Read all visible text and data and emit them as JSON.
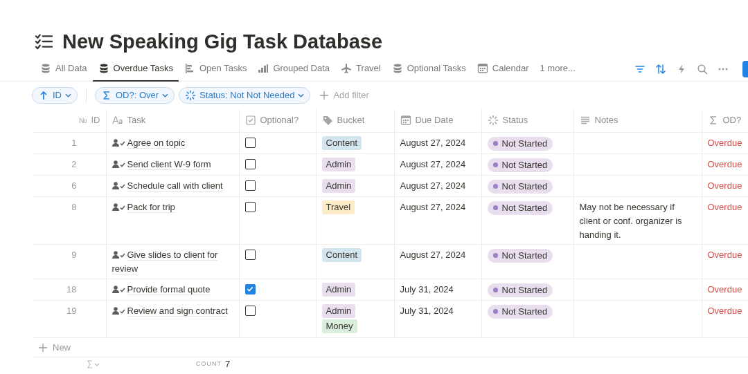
{
  "page": {
    "title": "New Speaking Gig Task Database"
  },
  "tabs": [
    {
      "label": "All Data",
      "kind": "database",
      "selected": false
    },
    {
      "label": "Overdue Tasks",
      "kind": "database",
      "selected": true
    },
    {
      "label": "Open Tasks",
      "kind": "timeline",
      "selected": false
    },
    {
      "label": "Grouped Data",
      "kind": "chart",
      "selected": false
    },
    {
      "label": "Travel",
      "kind": "plane",
      "selected": false
    },
    {
      "label": "Optional Tasks",
      "kind": "database",
      "selected": false
    },
    {
      "label": "Calendar",
      "kind": "calendar",
      "selected": false
    },
    {
      "label": "1 more...",
      "kind": "overflow",
      "selected": false
    }
  ],
  "toolbar": [
    {
      "kind": "filter",
      "active": true
    },
    {
      "kind": "sort",
      "active": true
    },
    {
      "kind": "automation",
      "active": false
    },
    {
      "kind": "search",
      "active": false
    },
    {
      "kind": "more",
      "active": false
    }
  ],
  "sorts": [
    {
      "label": "ID"
    }
  ],
  "filters": [
    {
      "label": "OD?: Over",
      "kind": "sigma"
    },
    {
      "label": "Status: Not Not Needed",
      "kind": "status"
    }
  ],
  "add_filter": "Add filter",
  "table": {
    "columns": [
      {
        "label": "ID",
        "kind": "number",
        "symbol": "№"
      },
      {
        "label": "Task",
        "kind": "title"
      },
      {
        "label": "Optional?",
        "kind": "checkbox"
      },
      {
        "label": "Bucket",
        "kind": "tag"
      },
      {
        "label": "Due Date",
        "kind": "calendar"
      },
      {
        "label": "Status",
        "kind": "status"
      },
      {
        "label": "Notes",
        "kind": "text"
      },
      {
        "label": "OD?",
        "kind": "sigma"
      }
    ],
    "rows": [
      {
        "id": "1",
        "task": "Agree on topic",
        "optional": false,
        "bucket": [
          {
            "label": "Content",
            "color": "#d3e5ef"
          }
        ],
        "due": "August 27, 2024",
        "status": {
          "label": "Not Started",
          "color": "#9b80c4"
        },
        "od": "Overdue"
      },
      {
        "id": "2",
        "task": "Send client W-9 form",
        "optional": false,
        "bucket": [
          {
            "label": "Admin",
            "color": "#e8deee"
          }
        ],
        "due": "August 27, 2024",
        "status": {
          "label": "Not Started",
          "color": "#9b80c4"
        },
        "od": "Overdue"
      },
      {
        "id": "6",
        "task": "Schedule call with client",
        "optional": false,
        "bucket": [
          {
            "label": "Admin",
            "color": "#e8deee"
          }
        ],
        "due": "August 27, 2024",
        "status": {
          "label": "Not Started",
          "color": "#9b80c4"
        },
        "od": "Overdue"
      },
      {
        "id": "8",
        "task": "Pack for trip",
        "optional": false,
        "bucket": [
          {
            "label": "Travel",
            "color": "#fdecc8"
          }
        ],
        "due": "August 27, 2024",
        "status": {
          "label": "Not Started",
          "color": "#9b80c4"
        },
        "notes": "May not be necessary if client or conf. organizer is handing it.",
        "od": "Overdue"
      },
      {
        "id": "9",
        "task": "Give slides to client for review",
        "optional": false,
        "bucket": [
          {
            "label": "Content",
            "color": "#d3e5ef"
          }
        ],
        "due": "August 27, 2024",
        "status": {
          "label": "Not Started",
          "color": "#9b80c4"
        },
        "od": "Overdue"
      },
      {
        "id": "18",
        "task": "Provide formal quote",
        "optional": true,
        "bucket": [
          {
            "label": "Admin",
            "color": "#e8deee"
          }
        ],
        "due": "July 31, 2024",
        "status": {
          "label": "Not Started",
          "color": "#9b80c4"
        },
        "od": "Overdue"
      },
      {
        "id": "19",
        "task": "Review and sign contract",
        "optional": false,
        "bucket": [
          {
            "label": "Admin",
            "color": "#e8deee"
          },
          {
            "label": "Money",
            "color": "#dbeddb"
          }
        ],
        "due": "July 31, 2024",
        "status": {
          "label": "Not Started",
          "color": "#9b80c4"
        },
        "od": "Overdue"
      }
    ],
    "new_row": "New",
    "footer": {
      "count_label": "COUNT",
      "count": "7"
    }
  }
}
